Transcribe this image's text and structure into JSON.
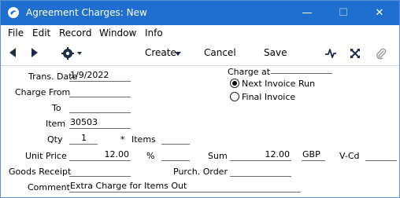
{
  "window": {
    "title": "Agreement Charges: New",
    "minimize_glyph": "—",
    "maximize_glyph": "☐",
    "close_glyph": "✕"
  },
  "menu": {
    "file": "File",
    "edit": "Edit",
    "record": "Record",
    "window": "Window",
    "info": "Info"
  },
  "toolbar": {
    "create": "Create",
    "cancel": "Cancel",
    "save": "Save"
  },
  "form": {
    "trans_date_label": "Trans. Date",
    "trans_date": "1/9/2022",
    "charge_from_label": "Charge From",
    "charge_from": "",
    "to_label": "To",
    "to": "",
    "item_label": "Item",
    "item": "30503",
    "qty_label": "Qty",
    "qty": "1",
    "star": "*",
    "items_label": "Items",
    "items": "",
    "unit_price_label": "Unit Price",
    "unit_price": "12.00",
    "percent_label": "%",
    "percent": "",
    "sum_label": "Sum",
    "sum": "12.00",
    "currency": "GBP",
    "vcd_label": "V-Cd",
    "vcd": "",
    "goods_receipt_label": "Goods Receipt",
    "goods_receipt": "",
    "purch_order_label": "Purch. Order",
    "purch_order": "",
    "comment_label": "Comment",
    "comment": "Extra Charge for Items Out",
    "charge_at_label": "Charge at",
    "radio_next_invoice": "Next Invoice Run",
    "radio_final_invoice": "Final Invoice",
    "selected_option": "Next Invoice Run"
  }
}
